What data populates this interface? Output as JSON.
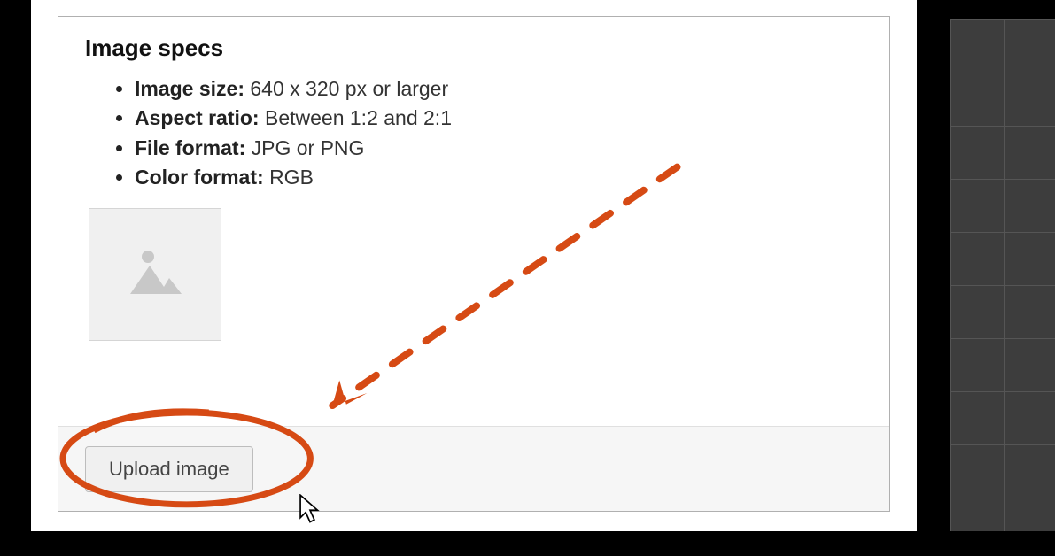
{
  "panel": {
    "title": "Image specs",
    "specs": [
      {
        "label": "Image size:",
        "value": "640 x 320 px or larger"
      },
      {
        "label": "Aspect ratio:",
        "value": "Between 1:2 and 2:1"
      },
      {
        "label": "File format:",
        "value": "JPG or PNG"
      },
      {
        "label": "Color format:",
        "value": "RGB"
      }
    ],
    "upload_label": "Upload image"
  },
  "annotation": {
    "color": "#d64a14",
    "type": "circle-with-dashed-arrow"
  }
}
